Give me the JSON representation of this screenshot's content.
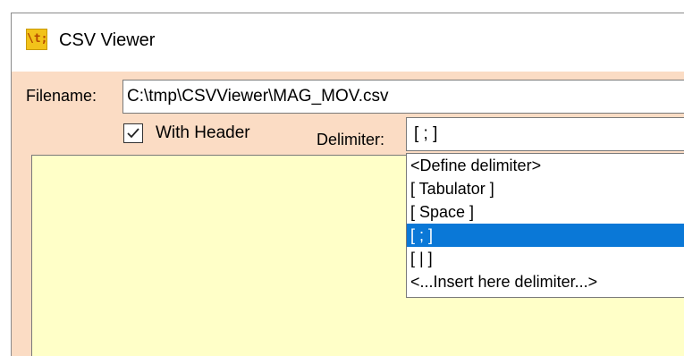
{
  "window": {
    "title": "CSV Viewer",
    "icon": "app-icon",
    "icon_text": "\\t;"
  },
  "form": {
    "filename_label": "Filename:",
    "filename_value": "C:\\tmp\\CSVViewer\\MAG_MOV.csv",
    "with_header_label": "With Header",
    "with_header_checked": true,
    "delimiter_label": "Delimiter:",
    "delimiter_value": "[ ; ]"
  },
  "dropdown": {
    "items": [
      {
        "label": "<Define delimiter>",
        "selected": false
      },
      {
        "label": "[ Tabulator ]",
        "selected": false
      },
      {
        "label": "[ Space ]",
        "selected": false
      },
      {
        "label": "[ ; ]",
        "selected": true
      },
      {
        "label": "[ | ]",
        "selected": false
      },
      {
        "label": "<...Insert here delimiter...>",
        "selected": false
      }
    ]
  },
  "colors": {
    "window_background": "#fbdcc4",
    "data_area_background": "#ffffc8",
    "selection": "#0a78d7"
  }
}
